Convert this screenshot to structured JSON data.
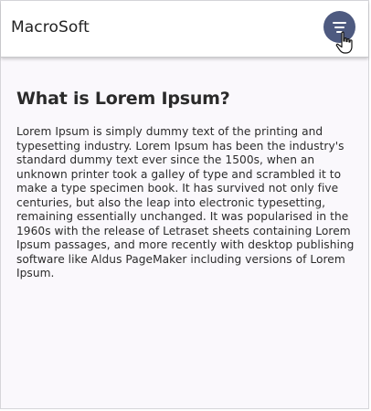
{
  "navbar": {
    "brand": "MacroSoft",
    "menu_icon": "hamburger-menu-icon",
    "accent_color": "#4e5a80"
  },
  "article": {
    "heading": "What is Lorem Ipsum?",
    "body": "Lorem Ipsum is simply dummy text of the printing and typesetting industry. Lorem Ipsum has been the industry's standard dummy text ever since the 1500s, when an unknown printer took a galley of type and scrambled it to make a type specimen book. It has survived not only five centuries, but also the leap into electronic typesetting, remaining essentially unchanged. It was popularised in the 1960s with the release of Letraset sheets containing Lorem Ipsum passages, and more recently with desktop publishing software like Aldus PageMaker including versions of Lorem Ipsum."
  },
  "cursor_icon": "hand-pointer-icon"
}
